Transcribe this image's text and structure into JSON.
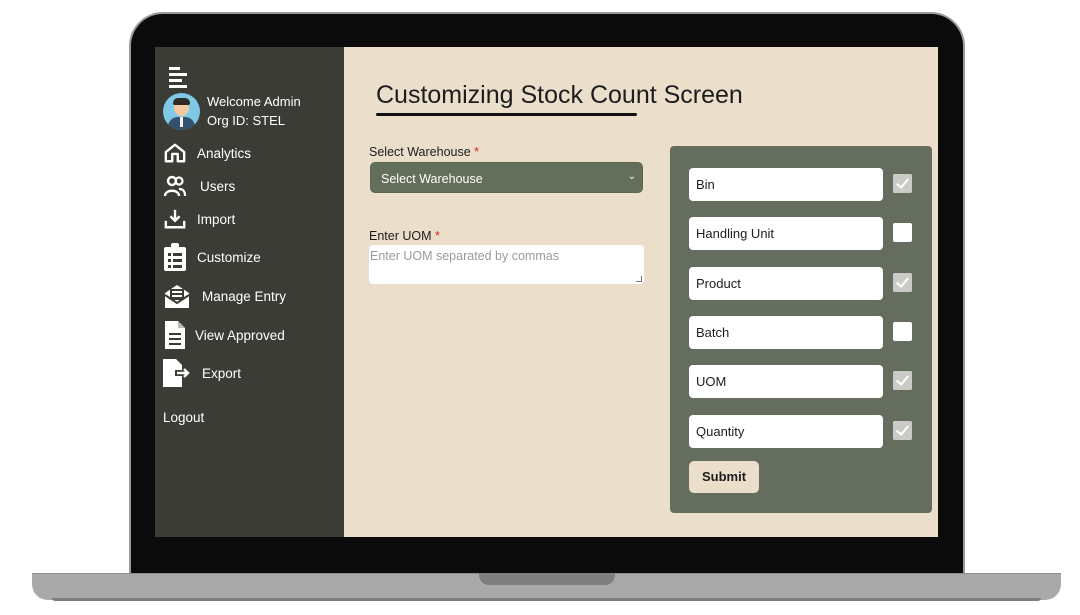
{
  "sidebar": {
    "welcome": "Welcome Admin",
    "org": "Org ID: STEL",
    "items": [
      {
        "label": "Analytics",
        "icon": "home-icon"
      },
      {
        "label": "Users",
        "icon": "users-icon"
      },
      {
        "label": "Import",
        "icon": "download-icon"
      },
      {
        "label": "Customize",
        "icon": "clipboard-list-icon"
      },
      {
        "label": "Manage Entry",
        "icon": "envelope-open-icon"
      },
      {
        "label": "View Approved",
        "icon": "document-icon"
      },
      {
        "label": "Export",
        "icon": "file-export-icon"
      }
    ],
    "logout": "Logout"
  },
  "main": {
    "title": "Customizing Stock Count Screen",
    "warehouse_label": "Select Warehouse",
    "warehouse_value": "Select Warehouse",
    "uom_label": "Enter UOM",
    "uom_placeholder": "Enter UOM separated by commas",
    "required_mark": "*"
  },
  "panel": {
    "columns": [
      {
        "label": "Bin",
        "checked": true
      },
      {
        "label": "Handling Unit",
        "checked": false
      },
      {
        "label": "Product",
        "checked": true
      },
      {
        "label": "Batch",
        "checked": false
      },
      {
        "label": "UOM",
        "checked": true
      },
      {
        "label": "Quantity",
        "checked": true
      }
    ],
    "submit_label": "Submit"
  },
  "colors": {
    "sidebar_bg": "#3b3c35",
    "content_bg": "#ebdecb",
    "panel_bg": "#656e5e",
    "select_bg": "#636f5b",
    "required": "#dd2222"
  }
}
